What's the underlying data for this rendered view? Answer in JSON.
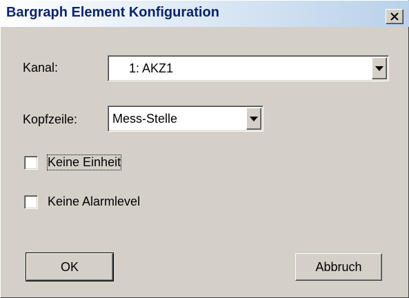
{
  "window": {
    "title": "Bargraph Element Konfiguration",
    "close_label": "×"
  },
  "form": {
    "kanal_label": "Kanal:",
    "kanal_value": "1: AKZ1",
    "kopfzeile_label": "Kopfzeile:",
    "kopfzeile_value": "Mess-Stelle",
    "keine_einheit_label": "Keine Einheit",
    "keine_einheit_checked": false,
    "keine_alarmlevel_label": "Keine Alarmlevel",
    "keine_alarmlevel_checked": false
  },
  "buttons": {
    "ok": "OK",
    "cancel": "Abbruch"
  },
  "colors": {
    "face": "#d4d0c8",
    "title_text": "#0a246a"
  }
}
